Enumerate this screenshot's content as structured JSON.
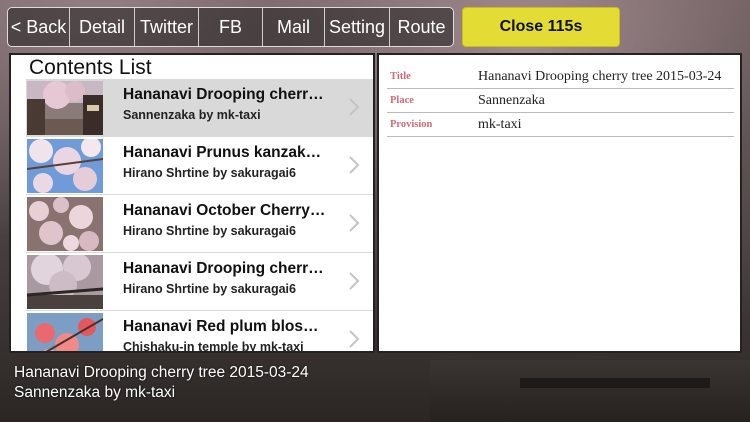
{
  "toolbar": {
    "back": "< Back",
    "detail": "Detail",
    "twitter": "Twitter",
    "fb": "FB",
    "mail": "Mail",
    "setting": "Setting",
    "route": "Route"
  },
  "close_button": "Close 115s",
  "list": {
    "title": "Contents List",
    "items": [
      {
        "title": "Hananavi Drooping cherr…",
        "subtitle": "Sannenzaka by mk-taxi",
        "thumb": "cherry-street-photo",
        "selected": true
      },
      {
        "title": "Hananavi Prunus kanzak…",
        "subtitle": "Hirano Shrtine by sakuragai6",
        "thumb": "cherry-blossom-sky-photo",
        "selected": false
      },
      {
        "title": "Hananavi October Cherry…",
        "subtitle": "Hirano Shrtine by sakuragai6",
        "thumb": "cherry-blossom-closeup-photo",
        "selected": false
      },
      {
        "title": "Hananavi Drooping cherr…",
        "subtitle": "Hirano Shrtine by sakuragai6",
        "thumb": "cherry-tree-roof-photo",
        "selected": false
      },
      {
        "title": "Hananavi Red plum blos…",
        "subtitle": "Chishaku-in temple by mk-taxi",
        "thumb": "red-plum-photo",
        "selected": false
      }
    ]
  },
  "detail": {
    "rows": [
      {
        "key": "Title",
        "value": "Hananavi Drooping cherry tree 2015-03-24"
      },
      {
        "key": "Place",
        "value": "Sannenzaka"
      },
      {
        "key": "Provision",
        "value": "mk-taxi"
      }
    ]
  },
  "caption": {
    "line1": "Hananavi Drooping cherry tree 2015-03-24",
    "line2": "Sannenzaka by mk-taxi"
  },
  "colors": {
    "close_button_bg": "#e3dc35",
    "detail_key": "#d56a78",
    "selected_row": "#d9d9d9"
  }
}
